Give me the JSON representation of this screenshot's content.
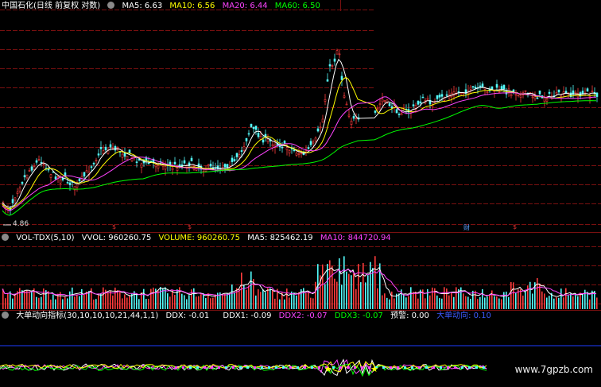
{
  "main": {
    "title": "中国石化(日线 前复权 对数)",
    "ma5": "MA5: 6.63",
    "ma10": "MA10: 6.56",
    "ma20": "MA20: 6.44",
    "ma60": "MA60: 6.50",
    "low_label": "4.86",
    "markers": [
      "$",
      "$",
      "财",
      "$"
    ]
  },
  "volume": {
    "title": "VOL-TDX(5,10)",
    "vvol": "VVOL: 960260.75",
    "volume": "VOLUME: 960260.75",
    "ma5": "MA5: 825462.19",
    "ma10": "MA10: 844720.94"
  },
  "ddx": {
    "title": "大单动向指标(30,10,10,10,21,44,1,1)",
    "ddx": "DDX: -0.01",
    "ddx1": "DDX1: -0.09",
    "ddx2": "DDX2: -0.07",
    "ddx3": "DDX3: -0.07",
    "warn": "预警: 0.00",
    "signal": "大单动向: 0.10"
  },
  "watermark": "www.7gpzb.com",
  "colors": {
    "up": "#ff3c3c",
    "down": "#54fcfc",
    "ma5": "#ffffff",
    "ma10": "#ffff00",
    "ma20": "#ff44ff",
    "ma60": "#00ff00",
    "grid": "#7a1010"
  }
}
